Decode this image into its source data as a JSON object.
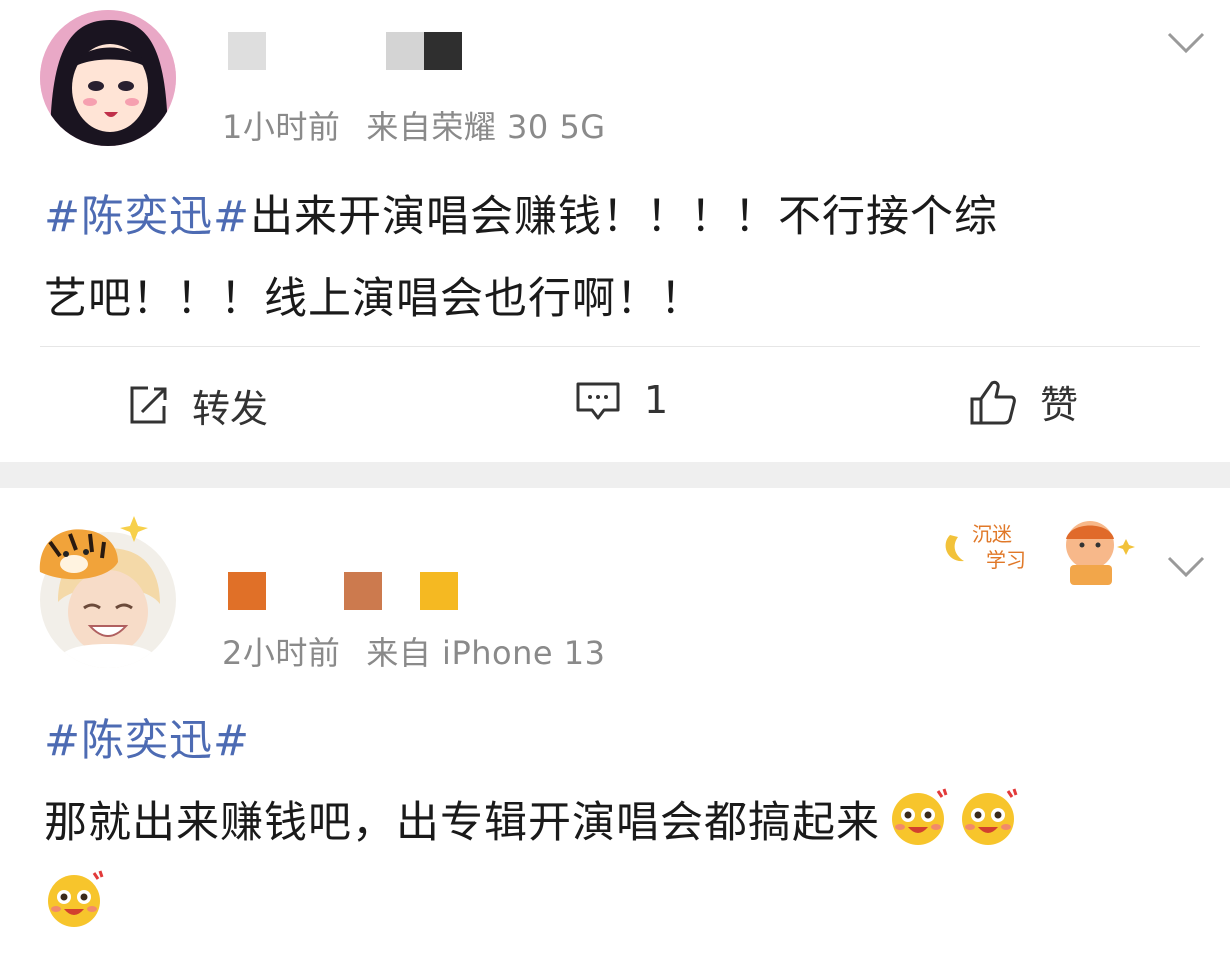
{
  "posts": [
    {
      "avatar": "anime-girl-avatar",
      "username_blocks": [
        "#d9d9d9",
        "#d0d0d0",
        "#2f2f2f"
      ],
      "time": "1小时前",
      "source": "来自荣耀 30 5G",
      "hashtag": "#陈奕迅#",
      "body_line1": "出来开演唱会赚钱！！！！不行接个综",
      "body_line2": "艺吧！！！线上演唱会也行啊！！",
      "actions": {
        "repost_label": "转发",
        "comment_count": "1",
        "like_label": "赞"
      }
    },
    {
      "avatar": "smiling-person-avatar",
      "username_blocks": [
        "#e07028",
        "#cc7a4e",
        "#f5b922"
      ],
      "time": "2小时前",
      "source": "来自 iPhone 13",
      "hashtag": "#陈奕迅#",
      "body_line1": "那就出来赚钱吧，出专辑开演唱会都搞起来",
      "badge_text": "沉迷学习"
    }
  ],
  "icons": {
    "chevron": "chevron-down-icon",
    "repost": "edit-share-icon",
    "comment": "comment-bubble-icon",
    "like": "thumbs-up-icon",
    "emoji": "excited-face-emoji"
  },
  "colors": {
    "hashtag": "#4d6bb3",
    "meta": "#8a8a8a",
    "divider": "#efefef"
  }
}
